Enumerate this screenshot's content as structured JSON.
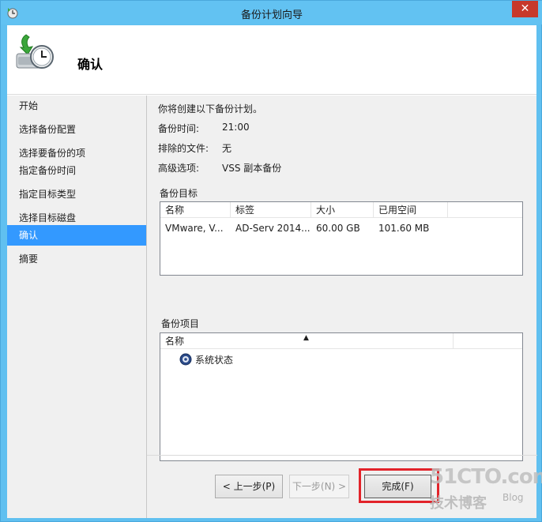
{
  "window": {
    "title": "备份计划向导",
    "close_glyph": "✕"
  },
  "header": {
    "title": "确认",
    "icon": "backup-schedule-icon"
  },
  "sidebar": {
    "items": [
      {
        "label": "开始",
        "active": false
      },
      {
        "label": "选择备份配置",
        "active": false
      },
      {
        "label": "选择要备份的项",
        "active": false
      },
      {
        "label": "指定备份时间",
        "active": false
      },
      {
        "label": "指定目标类型",
        "active": false
      },
      {
        "label": "选择目标磁盘",
        "active": false
      },
      {
        "label": "确认",
        "active": true
      },
      {
        "label": "摘要",
        "active": false
      }
    ]
  },
  "main": {
    "intro": "你将创建以下备份计划。",
    "fields": [
      {
        "label": "备份时间:",
        "value": "21:00"
      },
      {
        "label": "排除的文件:",
        "value": "无"
      },
      {
        "label": "高级选项:",
        "value": "VSS 副本备份"
      }
    ],
    "target": {
      "label": "备份目标",
      "columns": [
        "名称",
        "标签",
        "大小",
        "已用空间"
      ],
      "rows": [
        [
          "VMware, V...",
          "AD-Serv 2014...",
          "60.00 GB",
          "101.60 MB"
        ]
      ]
    },
    "items": {
      "label": "备份项目",
      "columns": [
        "名称"
      ],
      "sort_glyph": "▲",
      "rows": [
        {
          "name": "系统状态",
          "icon": "system-state-icon"
        }
      ]
    }
  },
  "buttons": {
    "prev": "< 上一步(P)",
    "next": "下一步(N) >",
    "finish": "完成(F)"
  },
  "watermark": {
    "site": "51CTO.com",
    "sub": "技术博客",
    "blog": "Blog"
  },
  "colors": {
    "title_bar": "#62c2f2",
    "active_nav": "#3399ff",
    "close": "#c7392b",
    "highlight": "#e2232a"
  }
}
